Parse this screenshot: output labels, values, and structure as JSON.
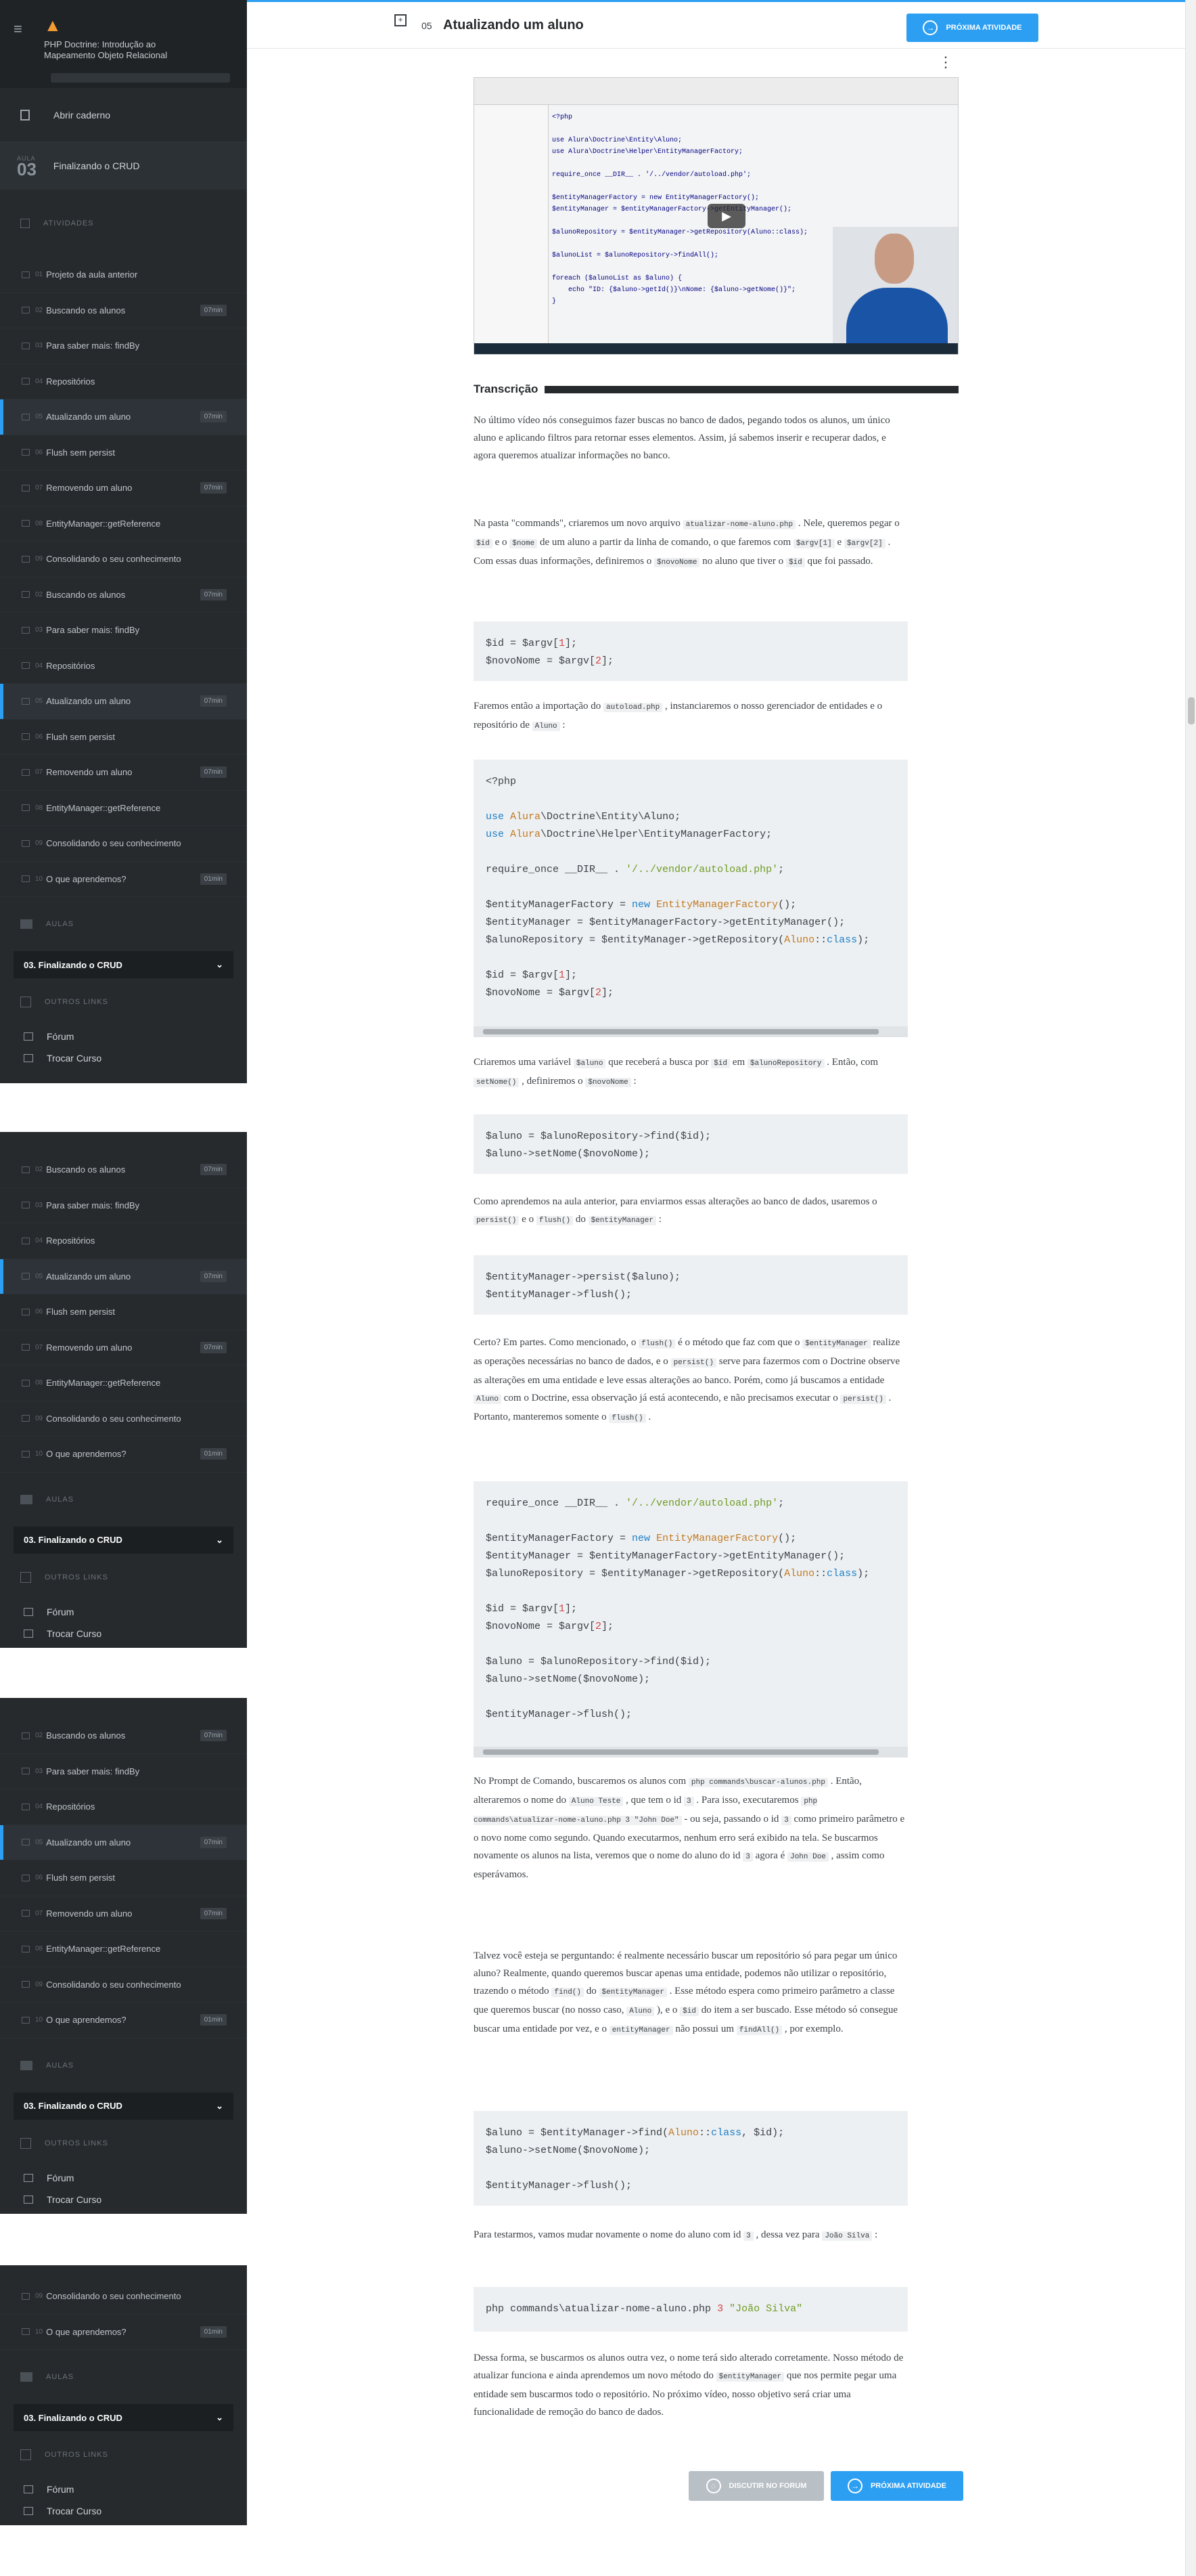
{
  "course": {
    "title": "PHP Doctrine: Introdução ao Mapeamento Objeto Relacional"
  },
  "nav": {
    "open_notebook": "Abrir caderno"
  },
  "lesson": {
    "label": "AULA",
    "number": "03",
    "name": "Finalizando o CRUD"
  },
  "activities_heading": "ATIVIDADES",
  "activities": [
    {
      "num": "01",
      "label": "Projeto da aula anterior",
      "time": ""
    },
    {
      "num": "02",
      "label": "Buscando os alunos",
      "time": "07min"
    },
    {
      "num": "03",
      "label": "Para saber mais: findBy",
      "time": ""
    },
    {
      "num": "04",
      "label": "Repositórios",
      "time": ""
    },
    {
      "num": "05",
      "label": "Atualizando um aluno",
      "time": "07min"
    },
    {
      "num": "06",
      "label": "Flush sem persist",
      "time": ""
    },
    {
      "num": "07",
      "label": "Removendo um aluno",
      "time": "07min"
    },
    {
      "num": "08",
      "label": "EntityManager::getReference",
      "time": ""
    },
    {
      "num": "09",
      "label": "Consolidando o seu conhecimento",
      "time": ""
    },
    {
      "num": "10",
      "label": "O que aprendemos?",
      "time": "01min"
    }
  ],
  "aulas_heading": "AULAS",
  "aulas_select": "03. Finalizando o CRUD",
  "other_links_heading": "OUTROS LINKS",
  "links": {
    "forum": "Fórum",
    "switch_course": "Trocar Curso"
  },
  "header": {
    "number": "05",
    "title": "Atualizando um aluno",
    "next_button": "PRÓXIMA ATIVIDADE"
  },
  "transcript_heading": "Transcrição",
  "footer": {
    "discuss_button": "DISCUTIR NO FORUM",
    "next_button": "PRÓXIMA ATIVIDADE"
  },
  "colors": {
    "accent": "#2c9ff2",
    "sidebar": "#262a2d"
  }
}
